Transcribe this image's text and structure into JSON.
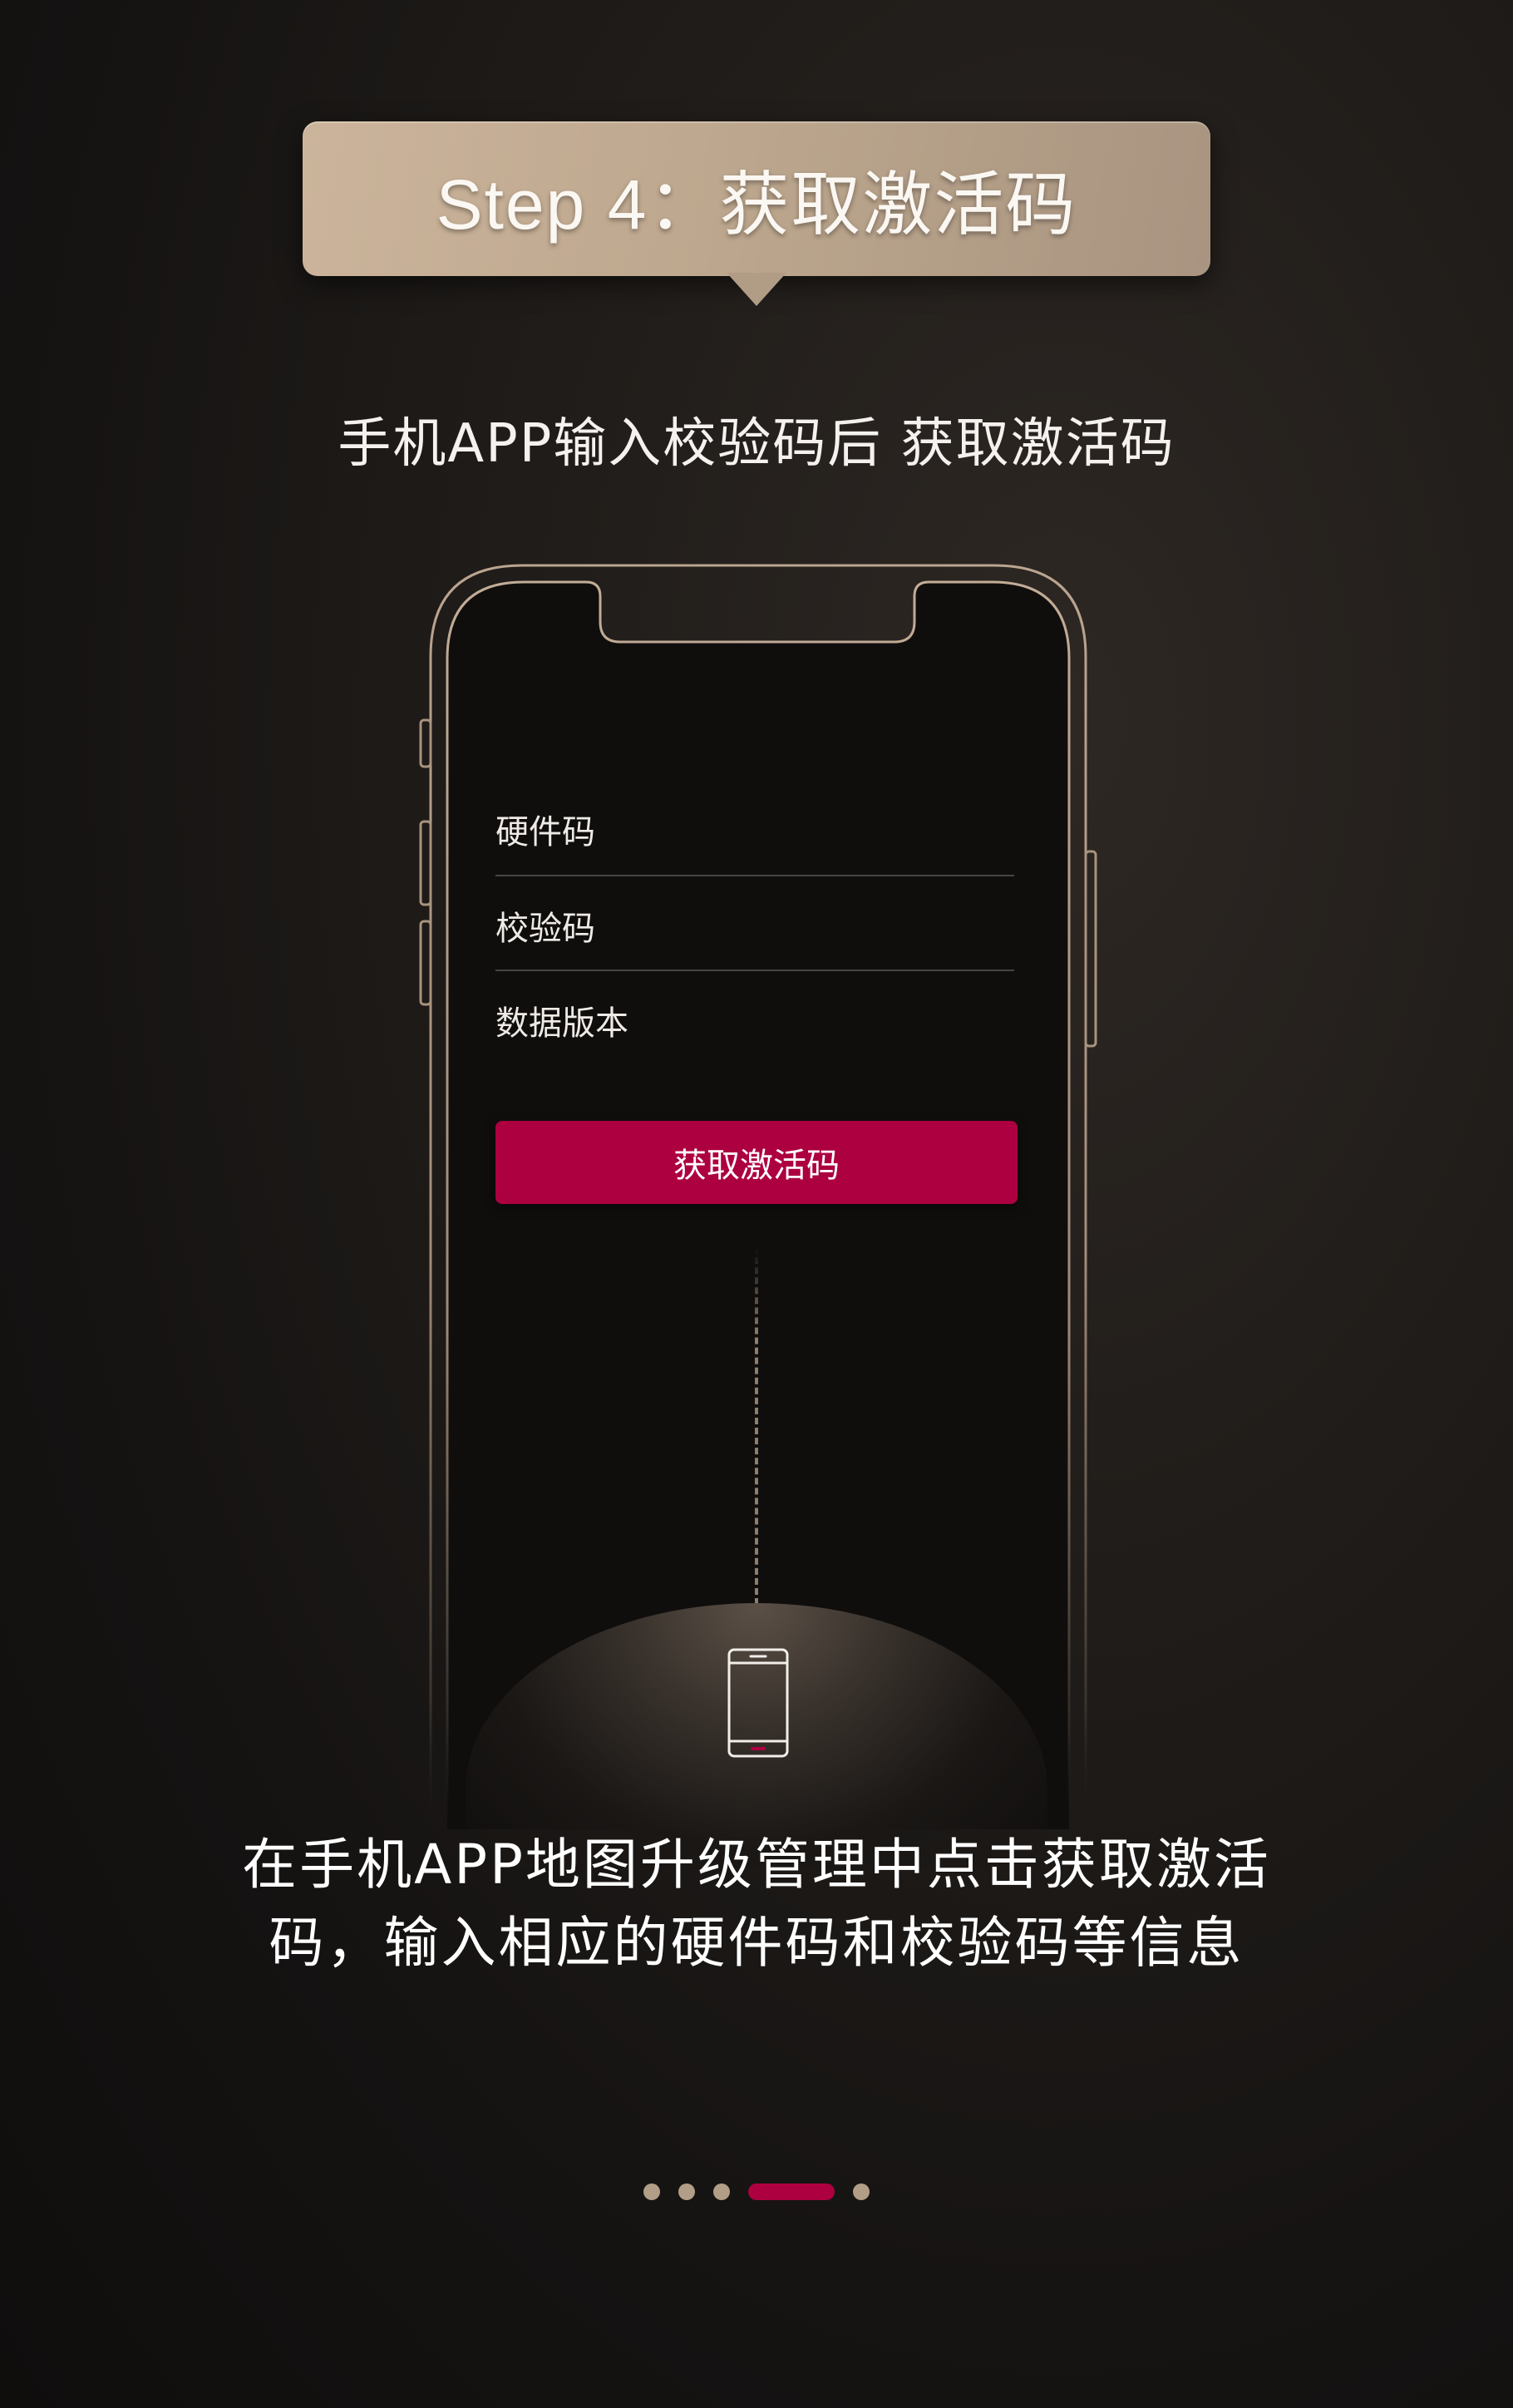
{
  "banner": {
    "title": "Step 4：获取激活码"
  },
  "subtitle": "手机APP输入校验码后 获取激活码",
  "phone_form": {
    "fields": [
      {
        "label": "硬件码"
      },
      {
        "label": "校验码"
      },
      {
        "label": "数据版本"
      }
    ],
    "button_label": "获取激活码"
  },
  "description": {
    "line1": "在手机APP地图升级管理中点击获取激活",
    "line2": "码，输入相应的硬件码和校验码等信息"
  },
  "pagination": {
    "total": 5,
    "active_index": 3
  },
  "colors": {
    "accent": "#ad0040",
    "gold": "#b29d86",
    "background": "#151312"
  },
  "icons": [
    "smartphone-icon"
  ]
}
